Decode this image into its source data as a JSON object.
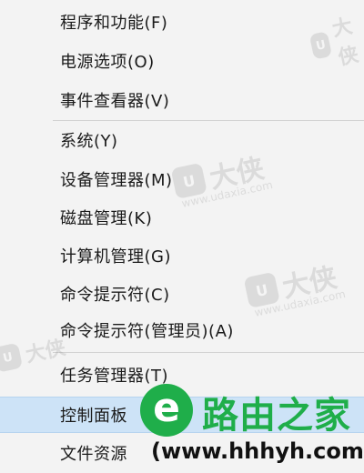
{
  "menu": {
    "items": [
      {
        "label": "程序和功能(F)"
      },
      {
        "label": "电源选项(O)"
      },
      {
        "label": "事件查看器(V)"
      },
      {
        "label": "系统(Y)"
      },
      {
        "label": "设备管理器(M)"
      },
      {
        "label": "磁盘管理(K)"
      },
      {
        "label": "计算机管理(G)"
      },
      {
        "label": "命令提示符(C)"
      },
      {
        "label": "命令提示符(管理员)(A)"
      },
      {
        "label": "任务管理器(T)"
      },
      {
        "label": "控制面板"
      },
      {
        "label": "文件资源"
      }
    ],
    "selected_index": 10
  },
  "watermark": {
    "badge": "U",
    "text": "大侠",
    "url": "www.udaxia.com"
  },
  "logo": {
    "icon": "e",
    "title": "路由之家",
    "url": "(www.hhhyh.com)"
  },
  "colors": {
    "selected_bg": "#cde3f7",
    "logo_green": "#1fae4a"
  }
}
